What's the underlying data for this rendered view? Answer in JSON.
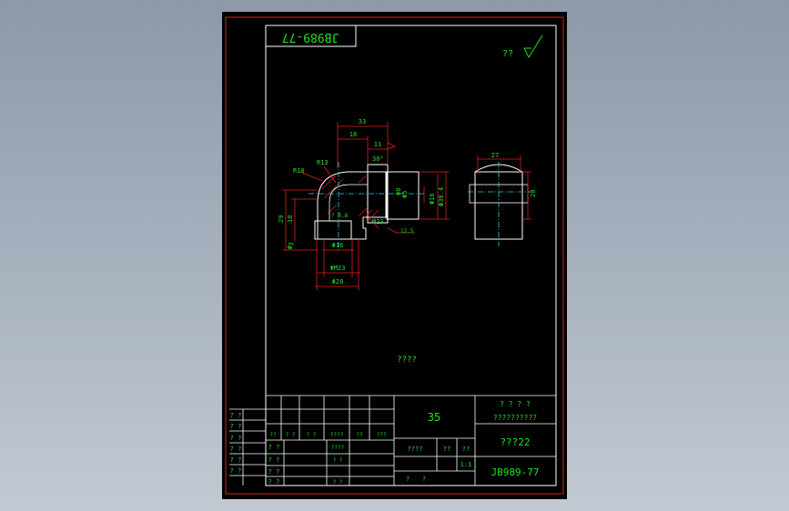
{
  "drawing_number_box": "JB989-77",
  "roughness_note": "??",
  "center_note": "????",
  "dimensions": {
    "top_overall": "33",
    "top_inner": "18",
    "top_small": "11",
    "r_outer": "R10",
    "r_inner": "R13",
    "angle": "30°",
    "dia_a": "Φ8",
    "dia_b": "Φ5",
    "dia_c": "Φ16",
    "dia_d": "Φ30.4",
    "left_height": "29",
    "left_height2": "18",
    "left_small": "Φ5",
    "bottom_dia1": "Φ16",
    "bottom_dia2": "ΦM23",
    "bottom_dia3": "Φ28",
    "thread": "M23",
    "right_width": "27",
    "right_height": "20",
    "tol_note": "? 0.8",
    "small_roughness": "12.5"
  },
  "title_block": {
    "quantity": "35",
    "head_label": "? ? ? ?",
    "sub_label": "??????????",
    "name": "???22",
    "code": "JB989-77",
    "scale_label": "????",
    "col_a": "??",
    "col_b": "??",
    "scale": "1:1",
    "sheet_a": "?",
    "sheet_b": "?",
    "left_col": [
      "? ?",
      "? ?",
      "? ?",
      "? ?",
      "? ?",
      "? ?"
    ],
    "rev_labels": [
      "??",
      "? ?",
      "? ?",
      "????",
      "??",
      "???"
    ],
    "sign_rows": [
      "? ?",
      "? ?",
      "? ?",
      "? ?"
    ],
    "sign_mid": [
      "????",
      "? ?",
      "? ?"
    ]
  },
  "colors": {
    "frame": "#e0201e",
    "border": "#ffffff",
    "dimension": "#e0201e",
    "dim_text": "#21e021",
    "part": "#ffffff",
    "center": "#22d0e6",
    "hatch": "#e0201e"
  }
}
